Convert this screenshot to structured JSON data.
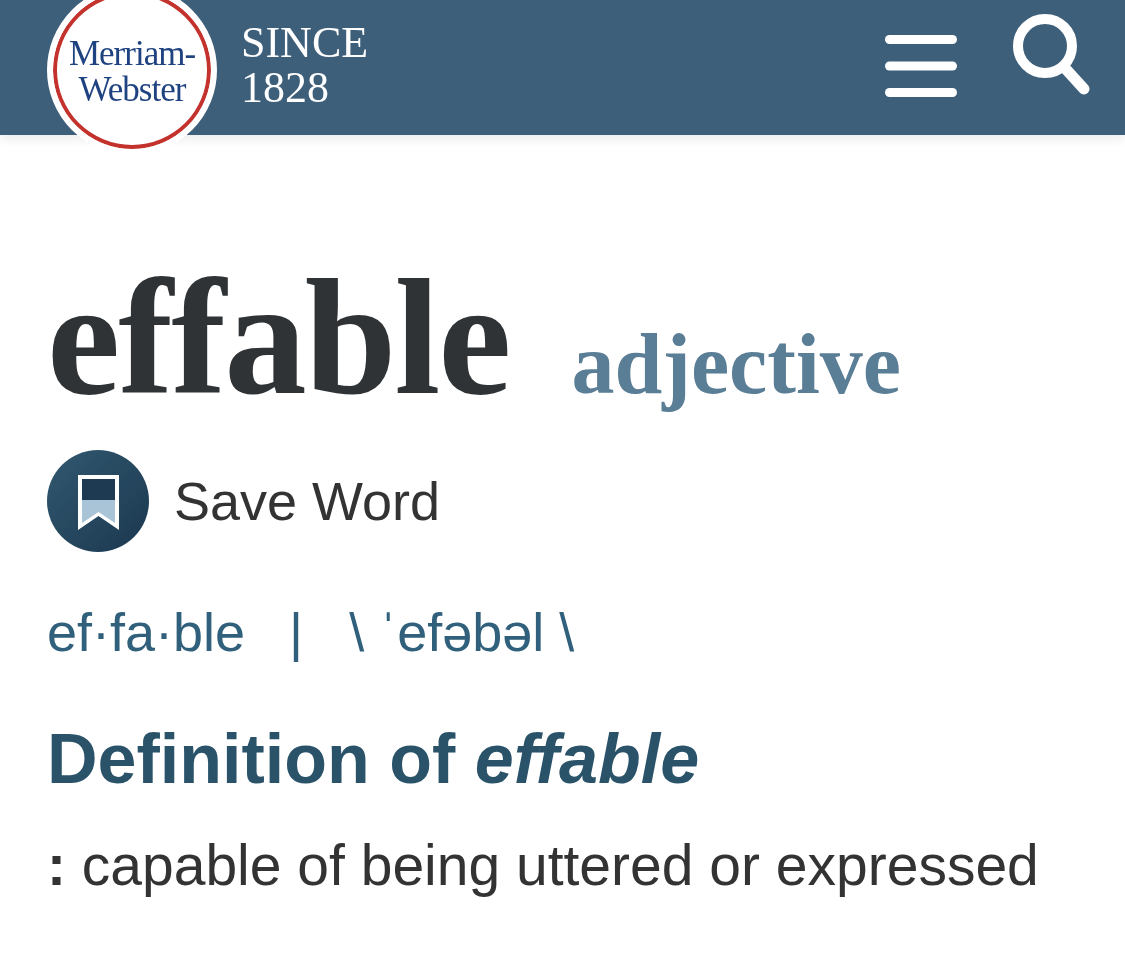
{
  "header": {
    "logo": {
      "wordmark": [
        "Merriam-",
        "Webster"
      ]
    },
    "tagline": [
      "SINCE",
      "1828"
    ]
  },
  "entry": {
    "headword": "effable",
    "part_of_speech": "adjective",
    "save_button": {
      "label": "Save Word"
    },
    "syllables": "ef·fa·ble",
    "separator": "|",
    "pronunciation": "\\ ˈefəbəl \\"
  },
  "definition": {
    "heading": "Definition of *effable*",
    "senses": [
      {
        "text": "**:** capable of being uttered or expressed"
      }
    ]
  }
}
